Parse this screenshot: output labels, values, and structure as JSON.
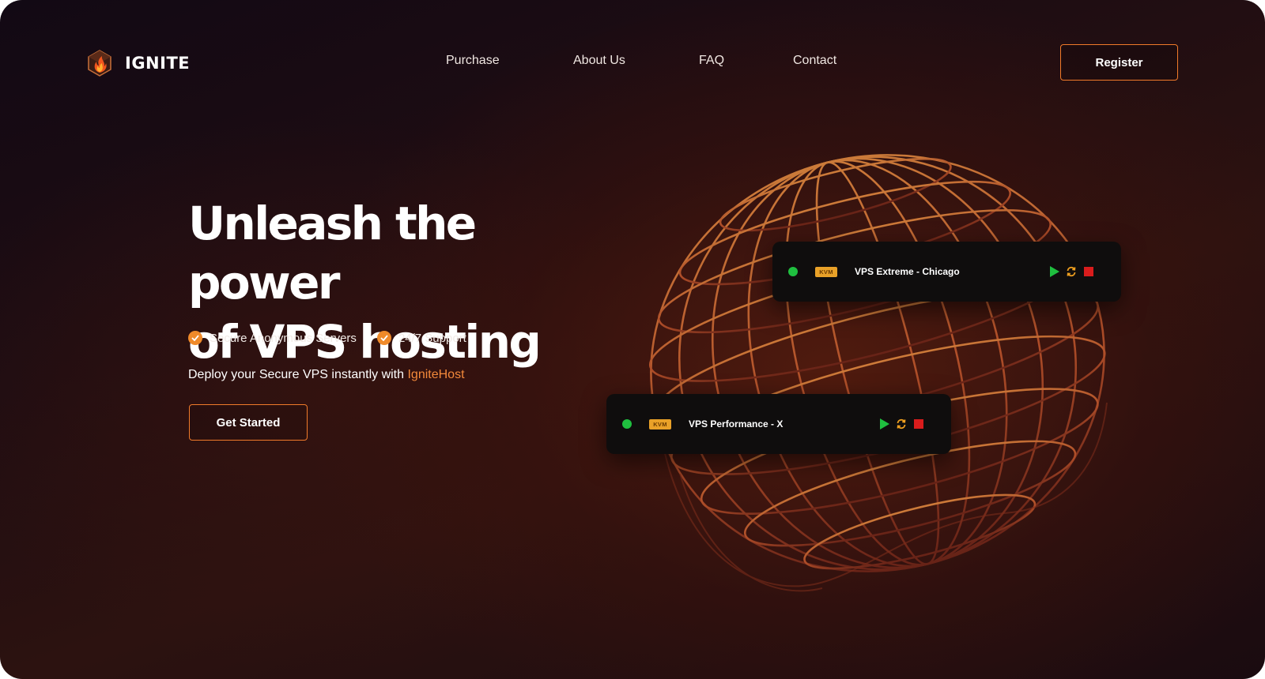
{
  "brand": {
    "name": "IGNITE",
    "logo_icon": "flame-cube-icon"
  },
  "nav": {
    "items": [
      "Purchase",
      "About Us",
      "FAQ",
      "Contact"
    ],
    "register_label": "Register"
  },
  "hero": {
    "title_line1": "Unleash the power",
    "title_line2": "of VPS hosting",
    "features": [
      "Secure Anonymous Servers",
      "24/7 Support"
    ],
    "deploy_text": "Deploy your Secure VPS instantly with ",
    "deploy_brand": "IgniteHost",
    "cta_label": "Get Started"
  },
  "servers": [
    {
      "badge": "KVM",
      "name": "VPS Extreme - Chicago",
      "status": "online"
    },
    {
      "badge": "KVM",
      "name": "VPS Performance - X",
      "status": "online"
    }
  ],
  "colors": {
    "accent": "#f07a2a",
    "status_online": "#1fbf3f",
    "play": "#1fbf3f",
    "restart": "#f0a020",
    "stop": "#d91c1c",
    "badge": "#e9a128"
  }
}
